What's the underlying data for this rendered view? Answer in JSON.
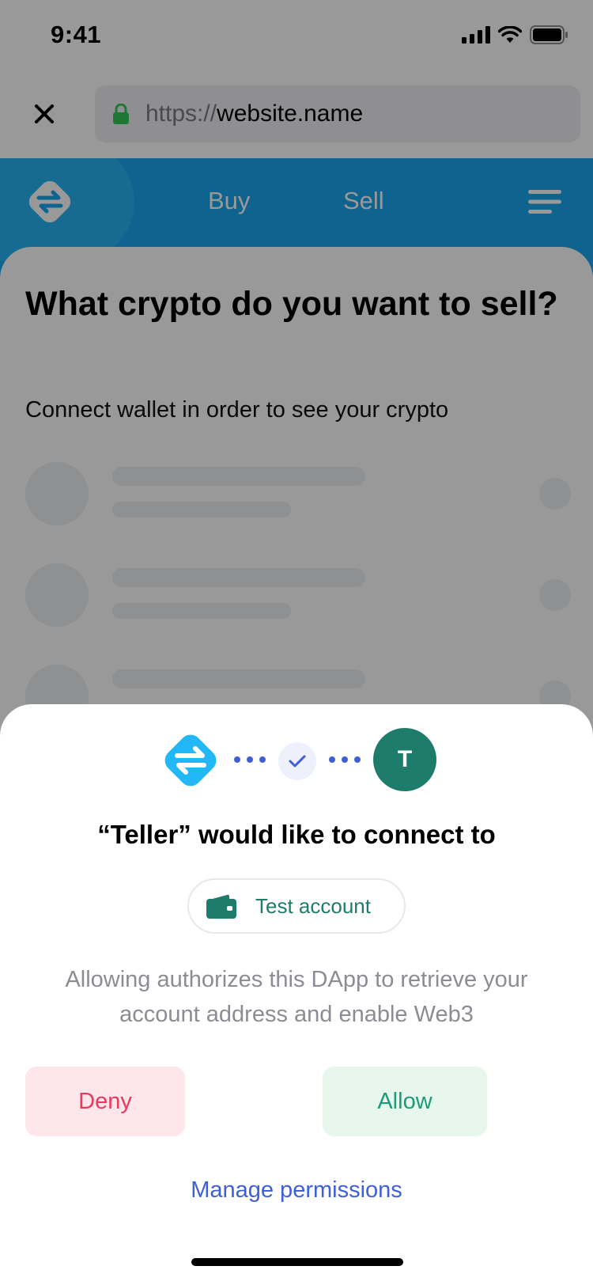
{
  "status_bar": {
    "time": "9:41"
  },
  "browser": {
    "url_scheme": "https://",
    "url_host": "website.name"
  },
  "site": {
    "nav": {
      "buy": "Buy",
      "sell": "Sell"
    },
    "title": "What crypto do you want to sell?",
    "subtitle": "Connect wallet in order to see your crypto"
  },
  "sheet": {
    "account_initial": "T",
    "title": "“Teller” would like to connect to",
    "account_name": "Test account",
    "description": "Allowing authorizes this DApp to retrieve your account address and enable Web3",
    "deny_label": "Deny",
    "allow_label": "Allow",
    "manage_label": "Manage permissions"
  },
  "colors": {
    "brand_blue": "#18a7ee",
    "account_green": "#1d7d6a",
    "deny_red": "#e53b5c",
    "allow_green": "#1d9a7a",
    "link_blue": "#3f5fd9"
  },
  "icons": [
    "signal-icon",
    "wifi-icon",
    "battery-icon",
    "close-icon",
    "lock-icon",
    "site-logo-icon",
    "menu-icon",
    "dapp-logo-icon",
    "check-icon",
    "wallet-icon"
  ]
}
